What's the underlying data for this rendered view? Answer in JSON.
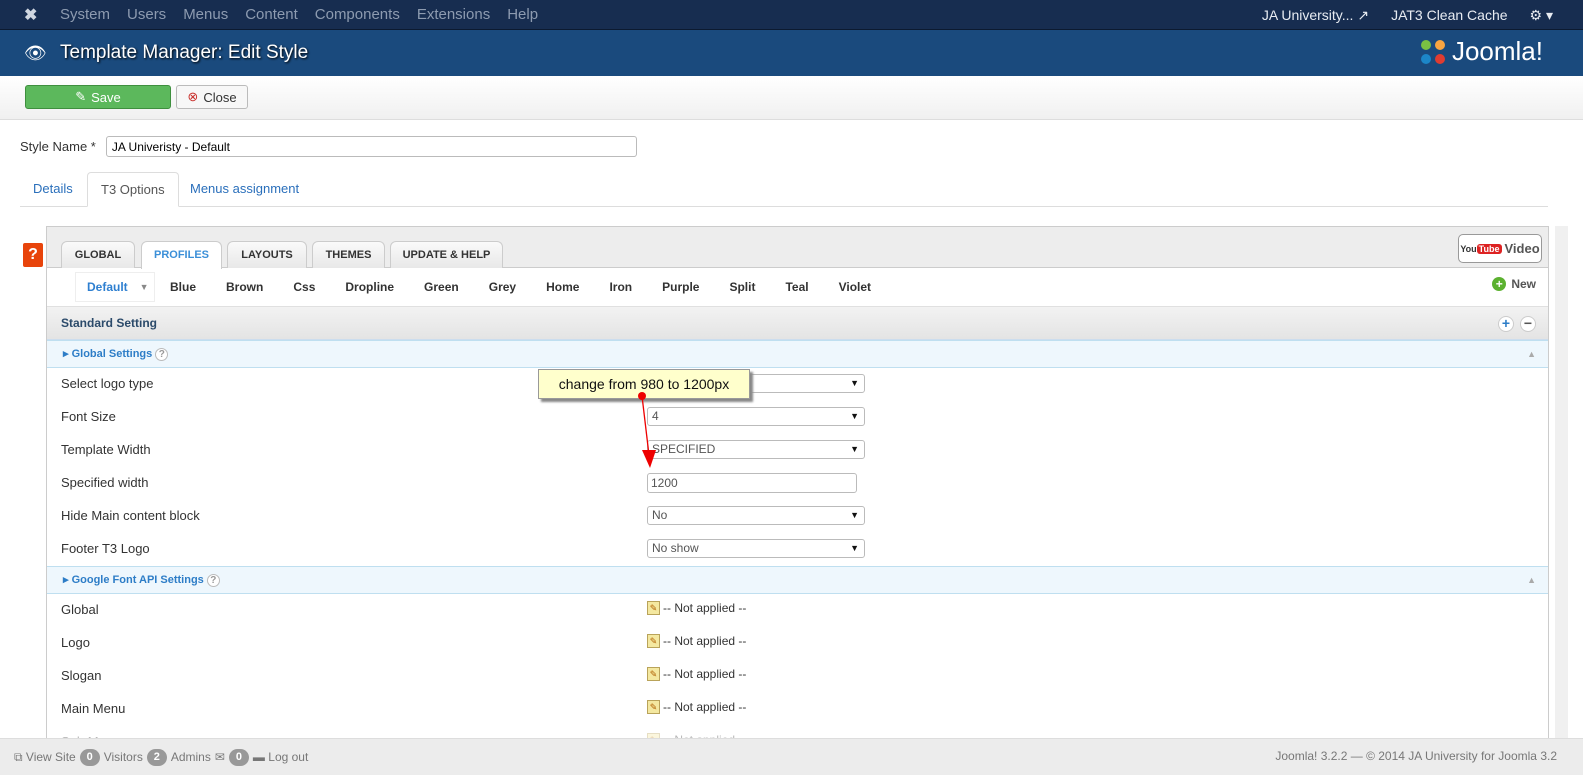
{
  "topnav": {
    "menu": [
      "System",
      "Users",
      "Menus",
      "Content",
      "Components",
      "Extensions",
      "Help"
    ],
    "site": "JA University...",
    "cache": "JAT3 Clean Cache"
  },
  "header": {
    "title": "Template Manager: Edit Style",
    "brand": "Joomla!"
  },
  "toolbar": {
    "save": "Save",
    "close": "Close"
  },
  "form": {
    "style_name_label": "Style Name *",
    "style_name_value": "JA Univeristy - Default"
  },
  "tabs": [
    "Details",
    "T3 Options",
    "Menus assignment"
  ],
  "t3": {
    "help": "?",
    "tabs": [
      "GLOBAL",
      "PROFILES",
      "LAYOUTS",
      "THEMES",
      "UPDATE & HELP"
    ],
    "video": "Video",
    "youtube_you": "You",
    "youtube_tube": "Tube",
    "profiles": [
      "Default",
      "Blue",
      "Brown",
      "Css",
      "Dropline",
      "Green",
      "Grey",
      "Home",
      "Iron",
      "Purple",
      "Split",
      "Teal",
      "Violet"
    ],
    "new": "New",
    "standard": "Standard Setting",
    "global_group": "Global Settings",
    "global_rows": [
      {
        "label": "Select logo type",
        "value": ""
      },
      {
        "label": "Font Size",
        "value": "4"
      },
      {
        "label": "Template Width",
        "value": "SPECIFIED"
      },
      {
        "label": "Specified width",
        "value": "1200"
      },
      {
        "label": "Hide Main content block",
        "value": "No"
      },
      {
        "label": "Footer T3 Logo",
        "value": "No show"
      }
    ],
    "font_group": "Google Font API Settings",
    "font_rows": [
      {
        "label": "Global",
        "value": "-- Not applied --"
      },
      {
        "label": "Logo",
        "value": "-- Not applied --"
      },
      {
        "label": "Slogan",
        "value": "-- Not applied --"
      },
      {
        "label": "Main Menu",
        "value": "-- Not applied --"
      },
      {
        "label": "Sub Menu",
        "value": "-- Not applied --"
      }
    ]
  },
  "annotation": "change from 980 to 1200px",
  "footer": {
    "view_site": "View Site",
    "visitors_count": "0",
    "visitors": "Visitors",
    "admins_count": "2",
    "admins": "Admins",
    "messages_count": "0",
    "logout": "Log out",
    "copyright": "Joomla! 3.2.2 — © 2014 JA University for Joomla 3.2"
  }
}
